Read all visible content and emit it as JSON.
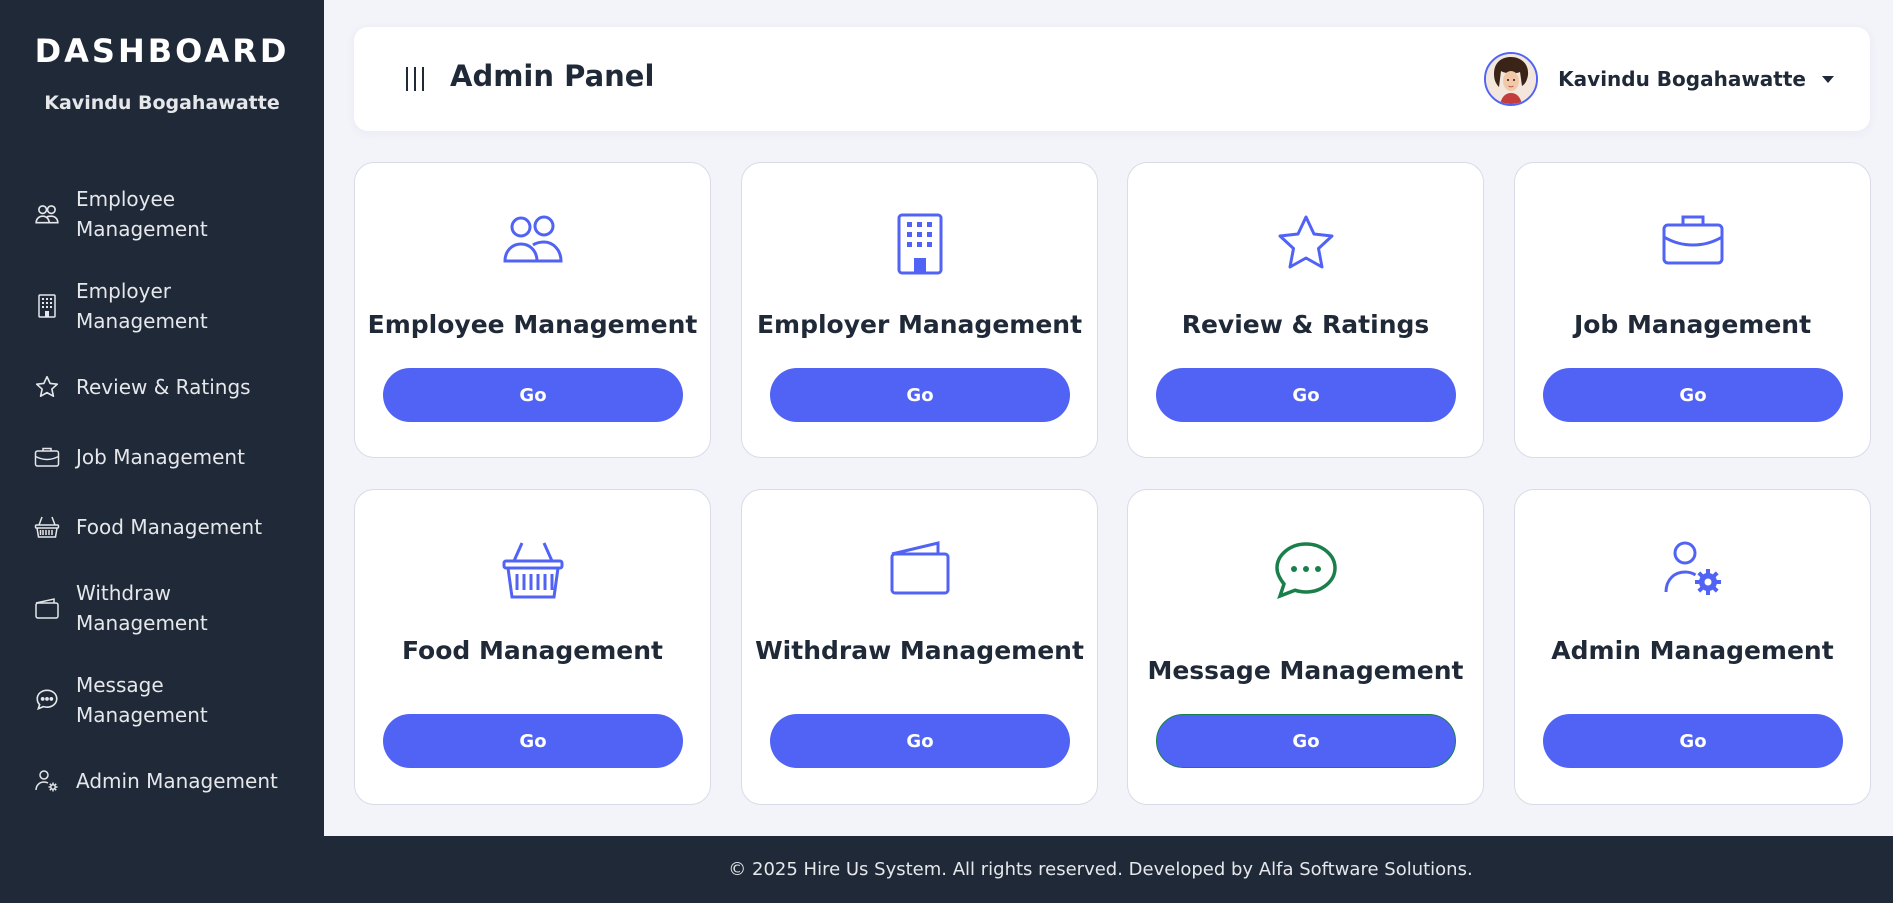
{
  "sidebar": {
    "brand": "DASHBOARD",
    "user_name": "Kavindu Bogahawatte",
    "items": [
      {
        "label": "Employee Management",
        "icon": "users-icon"
      },
      {
        "label": "Employer Management",
        "icon": "building-icon"
      },
      {
        "label": "Review & Ratings",
        "icon": "star-icon"
      },
      {
        "label": "Job Management",
        "icon": "briefcase-icon"
      },
      {
        "label": "Food Management",
        "icon": "basket-icon"
      },
      {
        "label": "Withdraw Management",
        "icon": "wallet-icon"
      },
      {
        "label": "Message Management",
        "icon": "chat-icon"
      },
      {
        "label": "Admin Management",
        "icon": "user-gear-icon"
      }
    ]
  },
  "header": {
    "title": "Admin Panel",
    "user_name": "Kavindu Bogahawatte"
  },
  "cards": [
    {
      "title": "Employee Management",
      "button": "Go",
      "icon": "users-icon"
    },
    {
      "title": "Employer Management",
      "button": "Go",
      "icon": "building-icon"
    },
    {
      "title": "Review & Ratings",
      "button": "Go",
      "icon": "star-icon"
    },
    {
      "title": "Job Management",
      "button": "Go",
      "icon": "briefcase-icon"
    },
    {
      "title": "Food Management",
      "button": "Go",
      "icon": "basket-icon"
    },
    {
      "title": "Withdraw Management",
      "button": "Go",
      "icon": "wallet-icon"
    },
    {
      "title": "Message Management",
      "button": "Go",
      "icon": "chat-icon"
    },
    {
      "title": "Admin Management",
      "button": "Go",
      "icon": "user-gear-icon"
    }
  ],
  "footer": {
    "text": "© 2025 Hire Us System. All rights reserved. Developed by Alfa Software Solutions."
  },
  "colors": {
    "sidebar_bg": "#1f2937",
    "accent": "#5063f5",
    "message_icon": "#1a7f4b",
    "page_bg": "#f3f4fa"
  }
}
